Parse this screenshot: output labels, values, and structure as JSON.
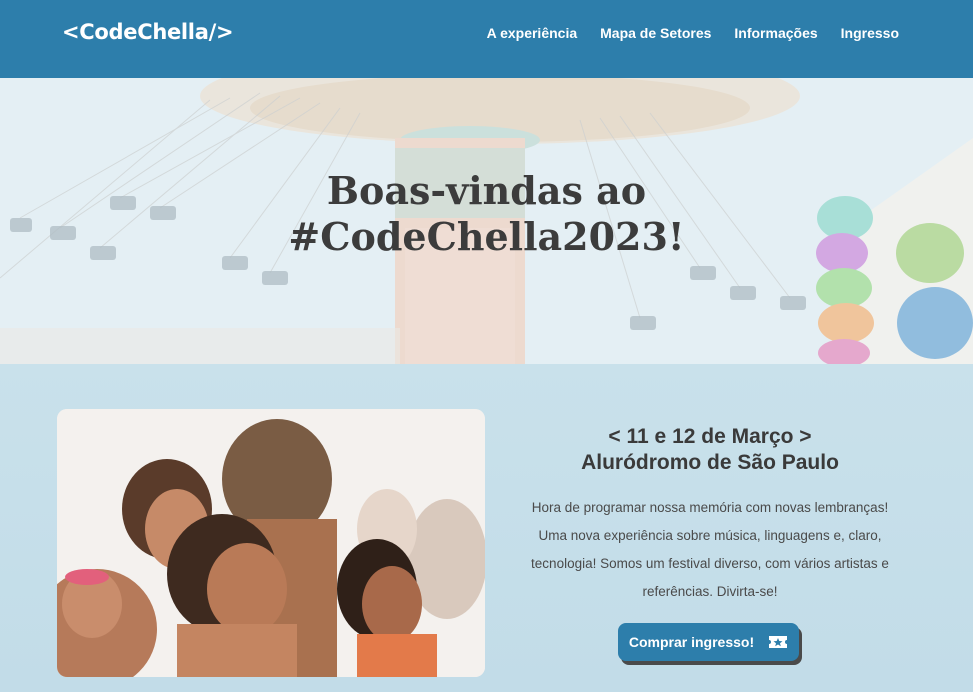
{
  "header": {
    "logo": "<CodeChella/>",
    "nav": [
      {
        "label": "A experiência"
      },
      {
        "label": "Mapa de Setores"
      },
      {
        "label": "Informações"
      },
      {
        "label": "Ingresso"
      }
    ]
  },
  "hero": {
    "title_line1": "Boas-vindas ao",
    "title_line2": "#CodeChella2023!"
  },
  "event": {
    "date": "< 11 e 12 de Março >",
    "place": "Aluródromo de São Paulo",
    "description": "Hora de programar nossa memória com novas lembranças! Uma nova experiência sobre música, linguagens e, claro, tecnologia! Somos um festival diverso, com vários artistas e referências. Divirta-se!",
    "buy_label": "Comprar ingresso!",
    "buy_icon": "ticket-star-icon"
  },
  "colors": {
    "header": "#2d7eab",
    "button": "#2d7eab",
    "background": "#c9e1eb",
    "title": "#3c3c3c"
  }
}
